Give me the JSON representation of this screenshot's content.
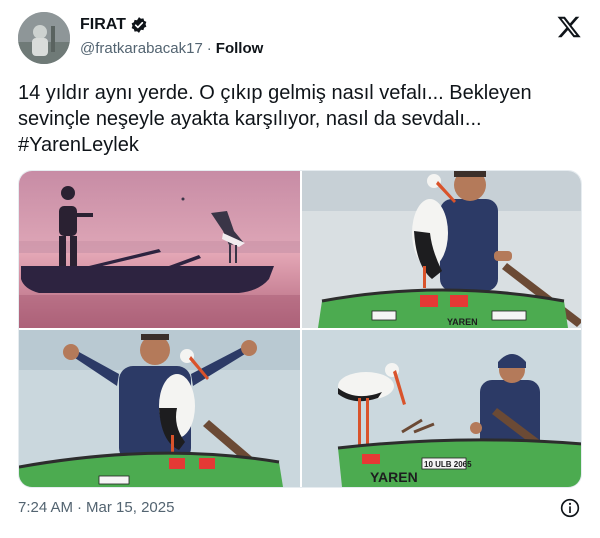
{
  "author": {
    "display_name": "FIRAT",
    "handle": "@fratkarabacak17",
    "separator": "·",
    "follow_label": "Follow"
  },
  "tweet": {
    "lines": [
      "14 yıldır aynı yerde. O çıkıp gelmiş nasıl vefalı... Bekleyen",
      "sevinçle neşeyle ayakta karşılıyor, nasıl da sevdalı..."
    ],
    "hashtag": "#YarenLeylek"
  },
  "media": {
    "boat_tags": [
      "YAREN",
      "10 ULB 2065",
      "YAREN",
      "10 ULB 2065"
    ]
  },
  "footer": {
    "time": "7:24 AM",
    "separator": "·",
    "date": "Mar 15, 2025"
  },
  "icons": {
    "verified": "verified-badge-icon",
    "logo": "x-logo-icon",
    "info": "info-icon"
  },
  "colors": {
    "text": "#0f1419",
    "muted": "#536471",
    "verified": "#0f1419",
    "boat_green": "#4caf50"
  }
}
